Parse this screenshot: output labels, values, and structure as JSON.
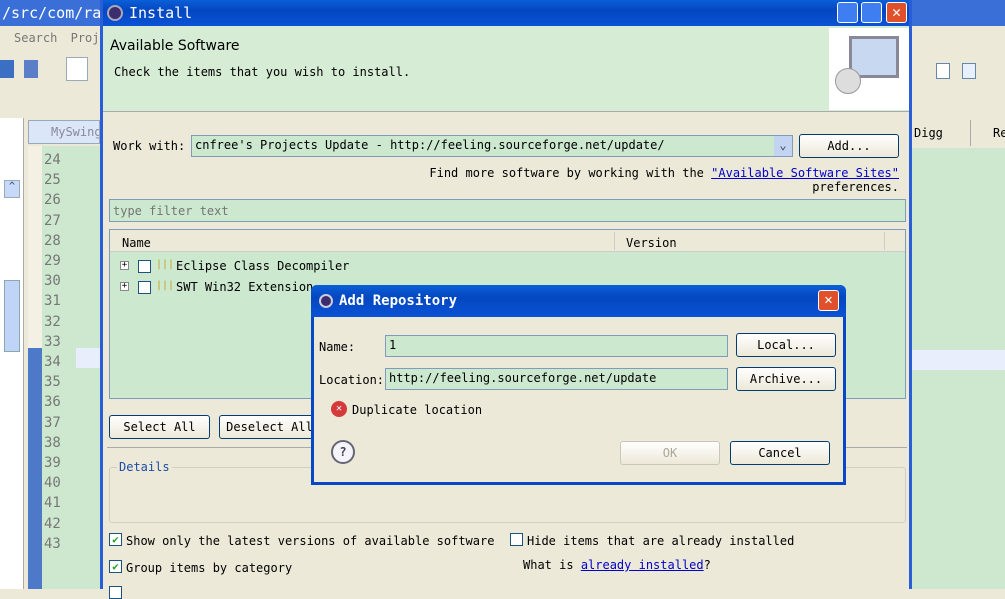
{
  "background_ide": {
    "title_fragment": "/src/com/ra",
    "menu": [
      "Search",
      "Proj"
    ],
    "editor_tab": "MySwing",
    "right_tabs": [
      "Digg",
      "Re"
    ],
    "line_numbers": [
      "24",
      "25",
      "26",
      "27",
      "28",
      "29",
      "30",
      "31",
      "32",
      "33",
      "34",
      "35",
      "36",
      "37",
      "38",
      "39",
      "40",
      "41",
      "42",
      "43"
    ]
  },
  "install": {
    "title": "Install",
    "header_title": "Available Software",
    "header_subtitle": "Check the items that you wish to install.",
    "work_with_label": "Work with:",
    "work_with_value": "cnfree's Projects Update - http://feeling.sourceforge.net/update/",
    "add_button": "Add...",
    "find_more_prefix": "Find more software by working with the",
    "find_more_link": "\"Available Software Sites\"",
    "find_more_suffix": "preferences.",
    "filter_placeholder": "type filter text",
    "columns": [
      "Name",
      "Version"
    ],
    "items": [
      {
        "label": "Eclipse Class Decompiler",
        "checked": false
      },
      {
        "label": "SWT Win32 Extension",
        "checked": false
      }
    ],
    "select_all": "Select All",
    "deselect_all": "Deselect All",
    "details_label": "Details",
    "options": [
      {
        "label": "Show only the latest versions of available software",
        "checked": true
      },
      {
        "label": "Group items by category",
        "checked": true
      },
      {
        "label": "Hide items that are already installed",
        "checked": false
      }
    ],
    "what_is_prefix": "What is",
    "what_is_link": "already installed",
    "what_is_suffix": "?"
  },
  "dialog": {
    "title": "Add Repository",
    "name_label": "Name:",
    "name_value": "1",
    "location_label": "Location:",
    "location_value": "http://feeling.sourceforge.net/update",
    "local_button": "Local...",
    "archive_button": "Archive...",
    "error_text": "Duplicate location",
    "ok_button": "OK",
    "cancel_button": "Cancel"
  }
}
